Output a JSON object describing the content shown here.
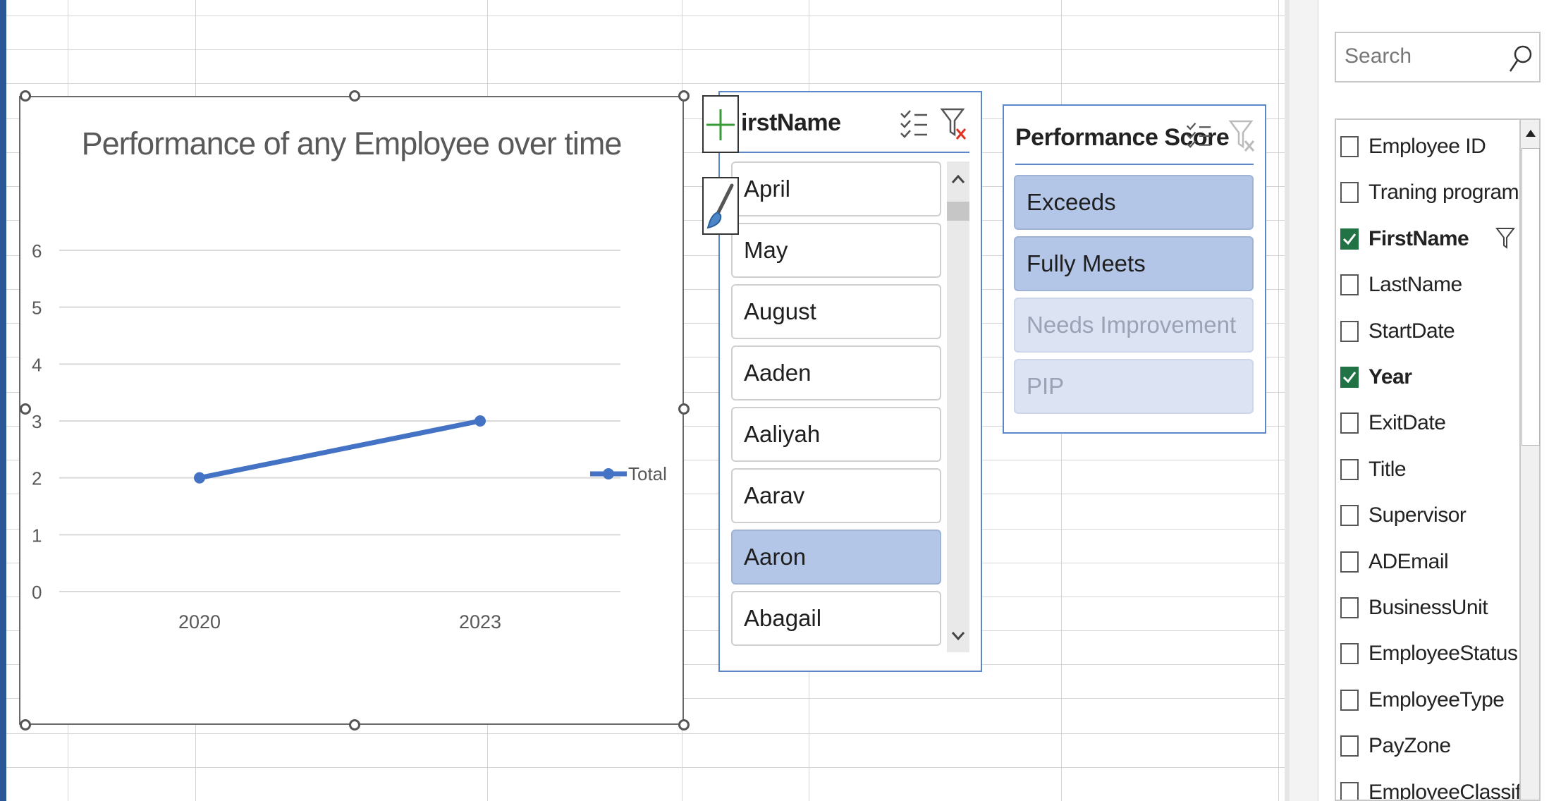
{
  "chart": {
    "title": "Performance of any Employee over time",
    "legend_label": "Total"
  },
  "chart_data": {
    "type": "line",
    "title": "Performance of any Employee over time",
    "categories": [
      "2020",
      "2023"
    ],
    "series": [
      {
        "name": "Total",
        "values": [
          2,
          3
        ]
      }
    ],
    "yticks": [
      "0",
      "1",
      "2",
      "3",
      "4",
      "5",
      "6"
    ],
    "ylim": [
      0,
      6
    ],
    "grid": true,
    "legend": "right",
    "color": "#4472c4"
  },
  "slicer_firstname": {
    "title": "irstName",
    "items": [
      {
        "label": "April",
        "state": "normal"
      },
      {
        "label": "May",
        "state": "normal"
      },
      {
        "label": "August",
        "state": "normal"
      },
      {
        "label": "Aaden",
        "state": "normal"
      },
      {
        "label": "Aaliyah",
        "state": "normal"
      },
      {
        "label": "Aarav",
        "state": "normal"
      },
      {
        "label": "Aaron",
        "state": "selected"
      },
      {
        "label": "Abagail",
        "state": "normal"
      }
    ]
  },
  "slicer_performance": {
    "title": "Performance Score",
    "items": [
      {
        "label": "Exceeds",
        "state": "selected"
      },
      {
        "label": "Fully Meets",
        "state": "selected"
      },
      {
        "label": "Needs Improvement",
        "state": "unavailable"
      },
      {
        "label": "PIP",
        "state": "unavailable"
      }
    ]
  },
  "field_pane": {
    "search_placeholder": "Search",
    "fields": [
      {
        "label": "Employee ID",
        "checked": false,
        "filtered": false
      },
      {
        "label": "Traning program ...",
        "checked": false,
        "filtered": false
      },
      {
        "label": "FirstName",
        "checked": true,
        "filtered": true
      },
      {
        "label": "LastName",
        "checked": false,
        "filtered": false
      },
      {
        "label": "StartDate",
        "checked": false,
        "filtered": false
      },
      {
        "label": "Year",
        "checked": true,
        "filtered": false
      },
      {
        "label": "ExitDate",
        "checked": false,
        "filtered": false
      },
      {
        "label": "Title",
        "checked": false,
        "filtered": false
      },
      {
        "label": "Supervisor",
        "checked": false,
        "filtered": false
      },
      {
        "label": "ADEmail",
        "checked": false,
        "filtered": false
      },
      {
        "label": "BusinessUnit",
        "checked": false,
        "filtered": false
      },
      {
        "label": "EmployeeStatus",
        "checked": false,
        "filtered": false
      },
      {
        "label": "EmployeeType",
        "checked": false,
        "filtered": false
      },
      {
        "label": "PayZone",
        "checked": false,
        "filtered": false
      },
      {
        "label": "EmployeeClassific...",
        "checked": false,
        "filtered": false
      }
    ]
  }
}
